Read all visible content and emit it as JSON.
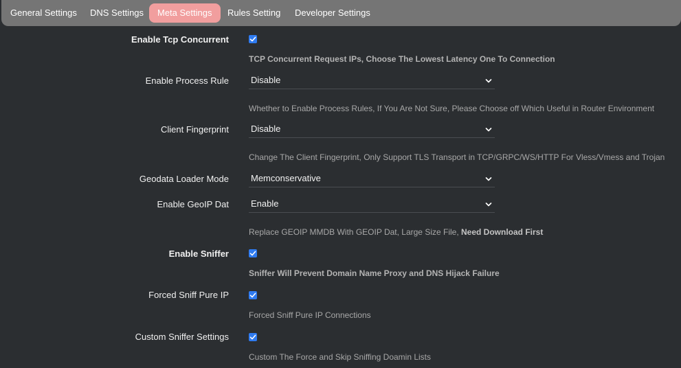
{
  "tabs": [
    {
      "label": "General Settings"
    },
    {
      "label": "DNS Settings"
    },
    {
      "label": "Meta Settings"
    },
    {
      "label": "Rules Setting"
    },
    {
      "label": "Developer Settings"
    }
  ],
  "active_tab": "Meta Settings",
  "accent_color": "#f19e9e",
  "checkbox_color": "#2f7bf0",
  "settings": {
    "tcp_concurrent": {
      "label": "Enable Tcp Concurrent",
      "checked": true,
      "description": "TCP Concurrent Request IPs, Choose The Lowest Latency One To Connection"
    },
    "process_rule": {
      "label": "Enable Process Rule",
      "value": "Disable",
      "description": "Whether to Enable Process Rules, If You Are Not Sure, Please Choose off Which Useful in Router Environment"
    },
    "client_fingerprint": {
      "label": "Client Fingerprint",
      "value": "Disable",
      "description": "Change The Client Fingerprint, Only Support TLS Transport in TCP/GRPC/WS/HTTP For Vless/Vmess and Trojan"
    },
    "geodata_loader": {
      "label": "Geodata Loader Mode",
      "value": "Memconservative"
    },
    "geoip_dat": {
      "label": "Enable GeoIP Dat",
      "value": "Enable",
      "description": "Replace GEOIP MMDB With GEOIP Dat, Large Size File, ",
      "description_strong": "Need Download First"
    },
    "sniffer": {
      "label": "Enable Sniffer",
      "checked": true,
      "description": "Sniffer Will Prevent Domain Name Proxy and DNS Hijack Failure"
    },
    "sniff_pure_ip": {
      "label": "Forced Sniff Pure IP",
      "checked": true,
      "description": "Forced Sniff Pure IP Connections"
    },
    "custom_sniffer": {
      "label": "Custom Sniffer Settings",
      "checked": true,
      "description": "Custom The Force and Skip Sniffing Doamin Lists"
    }
  }
}
